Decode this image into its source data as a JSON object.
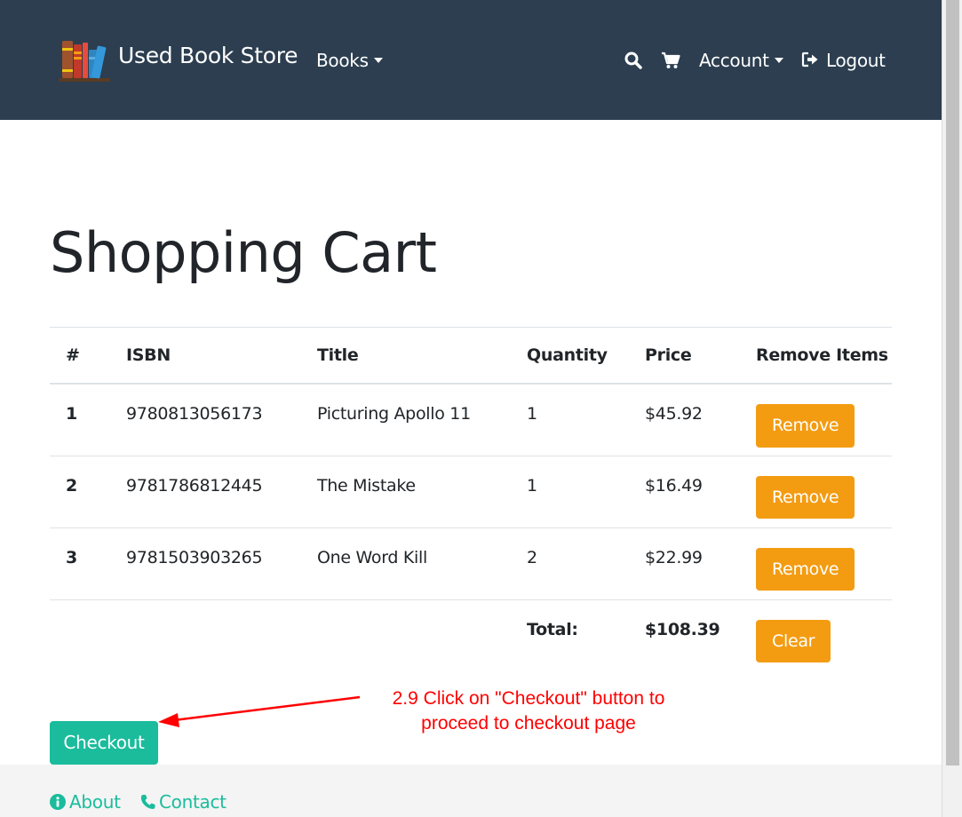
{
  "navbar": {
    "brand": "Used Book Store",
    "books_label": "Books",
    "account_label": "Account",
    "logout_label": "Logout",
    "icons": {
      "search": "search-icon",
      "cart": "cart-icon",
      "logout": "sign-out-icon",
      "logo": "books-logo-icon"
    }
  },
  "main": {
    "title": "Shopping Cart",
    "table": {
      "headers": [
        "#",
        "ISBN",
        "Title",
        "Quantity",
        "Price",
        "Remove Items"
      ],
      "rows": [
        {
          "num": "1",
          "isbn": "9780813056173",
          "title": "Picturing Apollo 11",
          "quantity": "1",
          "price": "$45.92",
          "action": "Remove"
        },
        {
          "num": "2",
          "isbn": "9781786812445",
          "title": "The Mistake",
          "quantity": "1",
          "price": "$16.49",
          "action": "Remove"
        },
        {
          "num": "3",
          "isbn": "9781503903265",
          "title": "One Word Kill",
          "quantity": "2",
          "price": "$22.99",
          "action": "Remove"
        }
      ],
      "total_label": "Total:",
      "total_value": "$108.39",
      "clear_label": "Clear"
    },
    "checkout_label": "Checkout",
    "annotation": {
      "line1": "2.9  Click on \"Checkout\" button to",
      "line2": "proceed to checkout page",
      "color": "#ff0000"
    }
  },
  "footer": {
    "about_label": "About",
    "contact_label": "Contact"
  },
  "colors": {
    "navbar_bg": "#2c3e50",
    "accent": "#1abc9c",
    "warning": "#f39c12",
    "footer_bg": "#f4f4f4"
  }
}
